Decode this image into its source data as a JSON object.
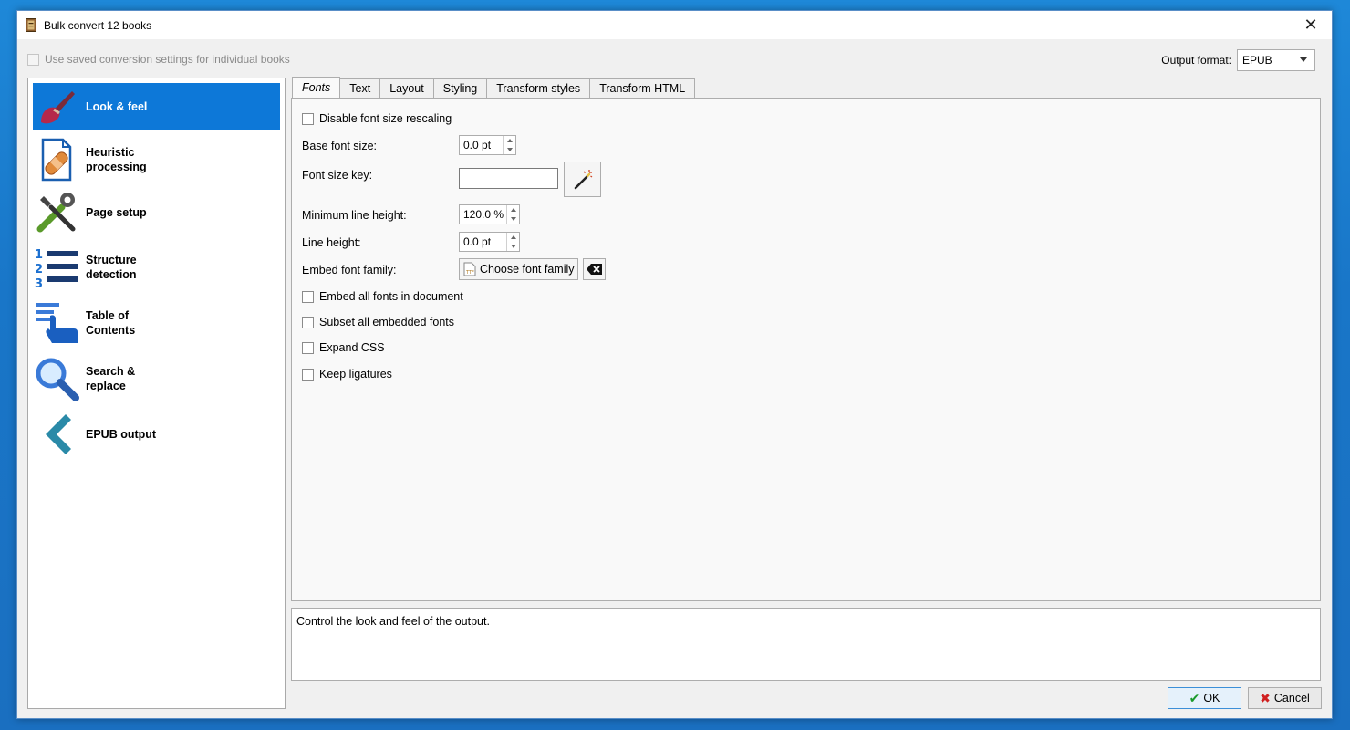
{
  "window": {
    "title": "Bulk convert 12 books"
  },
  "saved_settings": {
    "label": "Use saved conversion settings for individual books",
    "checked": false
  },
  "output_format": {
    "label": "Output format:",
    "value": "EPUB"
  },
  "sidebar": {
    "items": [
      {
        "label_line1": "Look & feel",
        "label_line2": "",
        "icon": "brush-icon",
        "active": true
      },
      {
        "label_line1": "Heuristic",
        "label_line2": "processing",
        "icon": "bandage-document-icon",
        "active": false
      },
      {
        "label_line1": "Page setup",
        "label_line2": "",
        "icon": "tools-icon",
        "active": false
      },
      {
        "label_line1": "Structure",
        "label_line2": "detection",
        "icon": "numbered-list-icon",
        "active": false
      },
      {
        "label_line1": "Table of",
        "label_line2": "Contents",
        "icon": "toc-hand-icon",
        "active": false
      },
      {
        "label_line1": "Search &",
        "label_line2": "replace",
        "icon": "magnifier-icon",
        "active": false
      },
      {
        "label_line1": "EPUB output",
        "label_line2": "",
        "icon": "epub-chevron-icon",
        "active": false
      }
    ]
  },
  "tabs": [
    {
      "label": "Fonts",
      "active": true
    },
    {
      "label": "Text",
      "active": false
    },
    {
      "label": "Layout",
      "active": false
    },
    {
      "label": "Styling",
      "active": false
    },
    {
      "label": "Transform styles",
      "active": false
    },
    {
      "label": "Transform HTML",
      "active": false
    }
  ],
  "fonts": {
    "disable_rescaling": {
      "label": "Disable font size rescaling",
      "checked": false
    },
    "base_font_size": {
      "label": "Base font size:",
      "value": "0.0 pt"
    },
    "font_size_key": {
      "label": "Font size key:",
      "value": ""
    },
    "min_line_height": {
      "label": "Minimum line height:",
      "value": "120.0 %"
    },
    "line_height": {
      "label": "Line height:",
      "value": "0.0 pt"
    },
    "embed_font_family": {
      "label": "Embed font family:",
      "button": "Choose font family"
    },
    "embed_all": {
      "label": "Embed all fonts in document",
      "checked": false
    },
    "subset_all": {
      "label": "Subset all embedded fonts",
      "checked": false
    },
    "expand_css": {
      "label": "Expand CSS",
      "checked": false
    },
    "keep_ligatures": {
      "label": "Keep ligatures",
      "checked": false
    }
  },
  "description": "Control the look and feel of the output.",
  "buttons": {
    "ok": "OK",
    "cancel": "Cancel"
  },
  "colors": {
    "selection": "#0d78d8",
    "window_bg": "#f0f0f0",
    "desktop": "#1a78cc"
  }
}
